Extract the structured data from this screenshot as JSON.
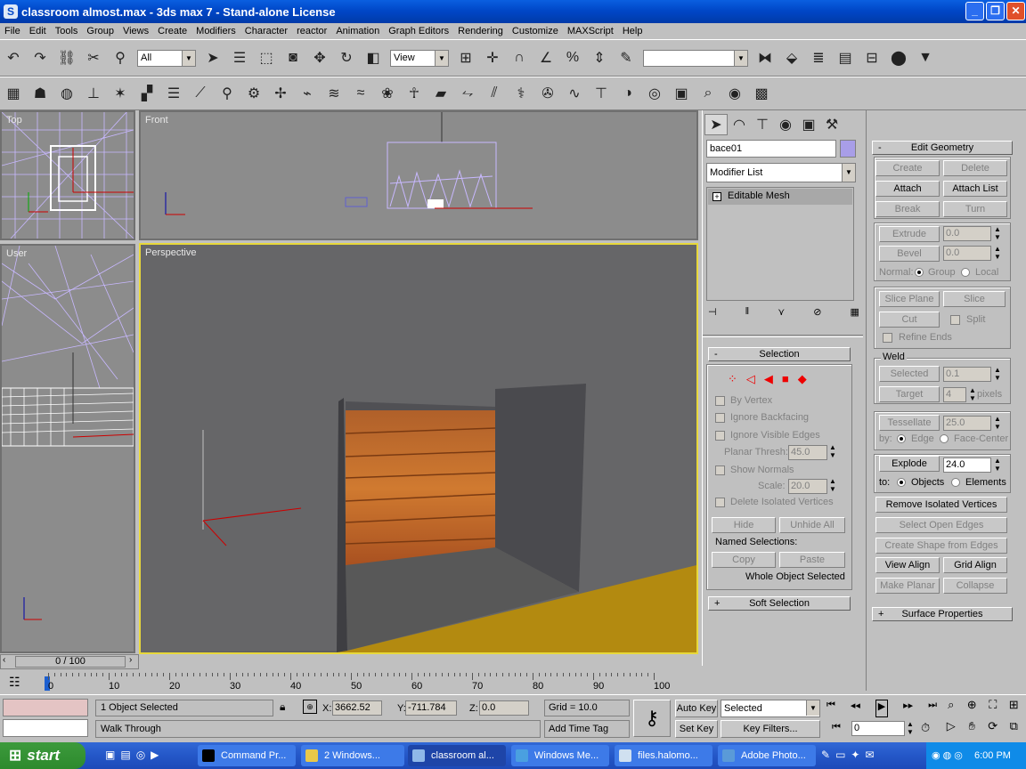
{
  "window": {
    "title": "classroom almost.max - 3ds max 7 - Stand-alone License"
  },
  "menu": [
    "File",
    "Edit",
    "Tools",
    "Group",
    "Views",
    "Create",
    "Modifiers",
    "Character",
    "reactor",
    "Animation",
    "Graph Editors",
    "Rendering",
    "Customize",
    "MAXScript",
    "Help"
  ],
  "toolbar": {
    "selection_filter": "All",
    "ref_coord": "View",
    "named_selection": ""
  },
  "viewports": {
    "top": "Top",
    "front": "Front",
    "user": "User",
    "perspective": "Perspective"
  },
  "command_panel": {
    "object_name": "bace01",
    "object_color": "#a89ee8",
    "modifier_list": "Modifier List",
    "stack_item": "Editable Mesh",
    "selection": {
      "title": "Selection",
      "by_vertex": "By Vertex",
      "ignore_backfacing": "Ignore Backfacing",
      "ignore_visible_edges": "Ignore Visible Edges",
      "planar_thresh_label": "Planar Thresh:",
      "planar_thresh": "45.0",
      "show_normals": "Show Normals",
      "scale_label": "Scale:",
      "scale": "20.0",
      "delete_isolated": "Delete Isolated Vertices",
      "hide": "Hide",
      "unhide_all": "Unhide All",
      "named_selections": "Named Selections:",
      "copy": "Copy",
      "paste": "Paste",
      "status": "Whole Object Selected"
    },
    "soft_selection": "Soft Selection",
    "edit_geometry": {
      "title": "Edit Geometry",
      "create": "Create",
      "delete": "Delete",
      "attach": "Attach",
      "attach_list": "Attach List",
      "break": "Break",
      "turn": "Turn",
      "extrude": "Extrude",
      "extrude_val": "0.0",
      "bevel": "Bevel",
      "bevel_val": "0.0",
      "normal_label": "Normal:",
      "group": "Group",
      "local": "Local",
      "slice_plane": "Slice Plane",
      "slice": "Slice",
      "cut": "Cut",
      "split": "Split",
      "refine_ends": "Refine Ends",
      "weld_title": "Weld",
      "selected": "Selected",
      "selected_val": "0.1",
      "target": "Target",
      "target_val": "4",
      "pixels": "pixels",
      "tessellate": "Tessellate",
      "tessellate_val": "25.0",
      "by_label": "by:",
      "edge": "Edge",
      "face_center": "Face-Center",
      "explode": "Explode",
      "explode_val": "24.0",
      "to_label": "to:",
      "objects": "Objects",
      "elements": "Elements",
      "remove_isolated": "Remove Isolated Vertices",
      "select_open_edges": "Select Open Edges",
      "create_shape": "Create Shape from Edges",
      "view_align": "View Align",
      "grid_align": "Grid Align",
      "make_planar": "Make Planar",
      "collapse": "Collapse"
    },
    "surface_properties": "Surface Properties"
  },
  "timeline": {
    "slider": "0 / 100",
    "ticks": [
      "0",
      "10",
      "20",
      "30",
      "40",
      "50",
      "60",
      "70",
      "80",
      "90",
      "100"
    ]
  },
  "status": {
    "selected": "1 Object Selected",
    "prompt": "Walk Through",
    "x_label": "X:",
    "x": "3662.52",
    "y_label": "Y:",
    "y": "-711.784",
    "z_label": "Z:",
    "z": "0.0",
    "grid": "Grid = 10.0",
    "add_time_tag": "Add Time Tag",
    "auto_key": "Auto Key",
    "set_key": "Set Key",
    "key_mode": "Selected",
    "key_filters": "Key Filters...",
    "frame": "0"
  },
  "taskbar": {
    "start": "start",
    "tasks": [
      "Command Pr...",
      "2 Windows...",
      "classroom al...",
      "Windows Me...",
      "files.halomo...",
      "Adobe Photo..."
    ],
    "time": "6:00 PM"
  }
}
